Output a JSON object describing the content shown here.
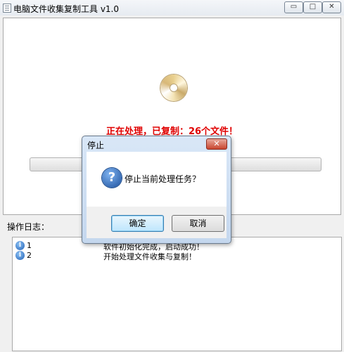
{
  "window": {
    "title": "电脑文件收集复制工具 v1.0",
    "minimize_glyph": "▭",
    "maximize_glyph": "□",
    "close_glyph": "✕"
  },
  "main": {
    "icon": "disc-icon",
    "status": "正在处理，已复制：26个文件！",
    "progress": 0
  },
  "log": {
    "label": "操作日志：",
    "entries": [
      {
        "num": "1",
        "msg": "软件初始化完成，启动成功！",
        "icon": "info-icon",
        "icon_glyph": "i"
      },
      {
        "num": "2",
        "msg": "开始处理文件收集与复制！",
        "icon": "info-icon",
        "icon_glyph": "i"
      }
    ]
  },
  "dialog": {
    "title": "停止",
    "close_glyph": "✕",
    "icon": "question-icon",
    "icon_glyph": "?",
    "message": "停止当前处理任务？",
    "ok_label": "确定",
    "cancel_label": "取消"
  }
}
